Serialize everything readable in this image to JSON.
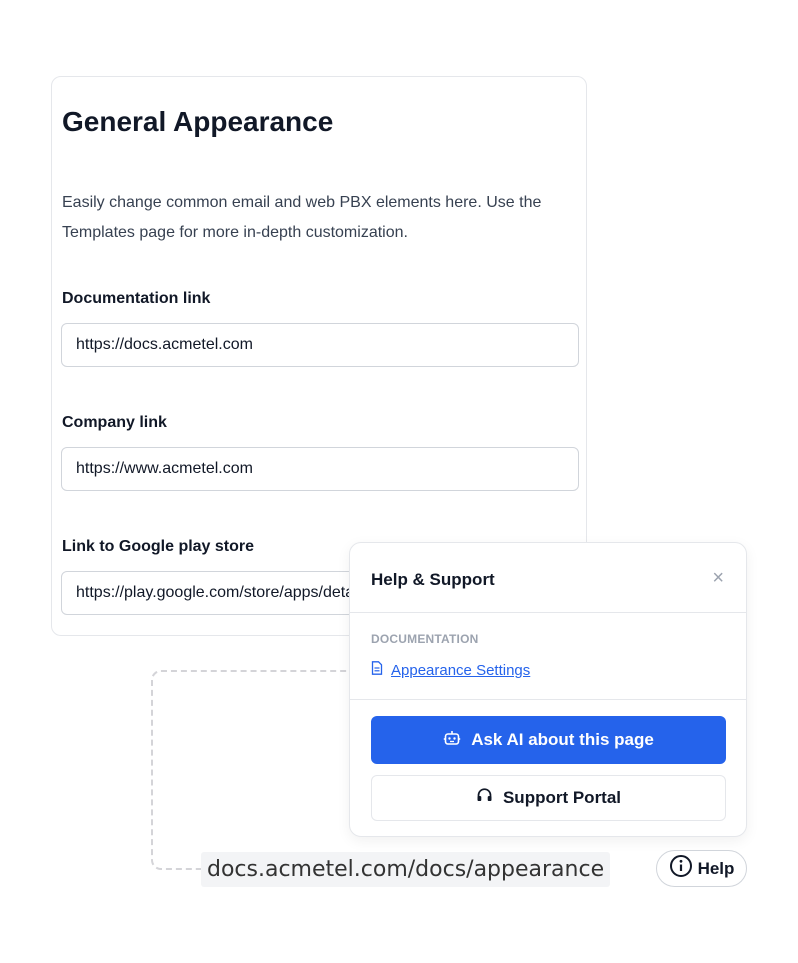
{
  "card": {
    "title": "General Appearance",
    "description": "Easily change common email and web PBX elements here. Use the Templates page for more in-depth customization.",
    "fields": [
      {
        "label": "Documentation link",
        "value": "https://docs.acmetel.com"
      },
      {
        "label": "Company link",
        "value": "https://www.acmetel.com"
      },
      {
        "label": "Link to Google play store",
        "value": "https://play.google.com/store/apps/details"
      }
    ]
  },
  "url_chip": "docs.acmetel.com/docs/appearance",
  "help_panel": {
    "title": "Help & Support",
    "close_symbol": "×",
    "section_label": "DOCUMENTATION",
    "doc_link": "Appearance Settings",
    "primary_button": "Ask AI about this page",
    "secondary_button": "Support Portal"
  },
  "help_button": "Help",
  "colors": {
    "accent": "#2563eb",
    "border": "#e5e7eb",
    "muted": "#9ca3af"
  },
  "icons": [
    "document-icon",
    "robot-icon",
    "headset-icon",
    "info-circle-icon",
    "close-icon"
  ]
}
